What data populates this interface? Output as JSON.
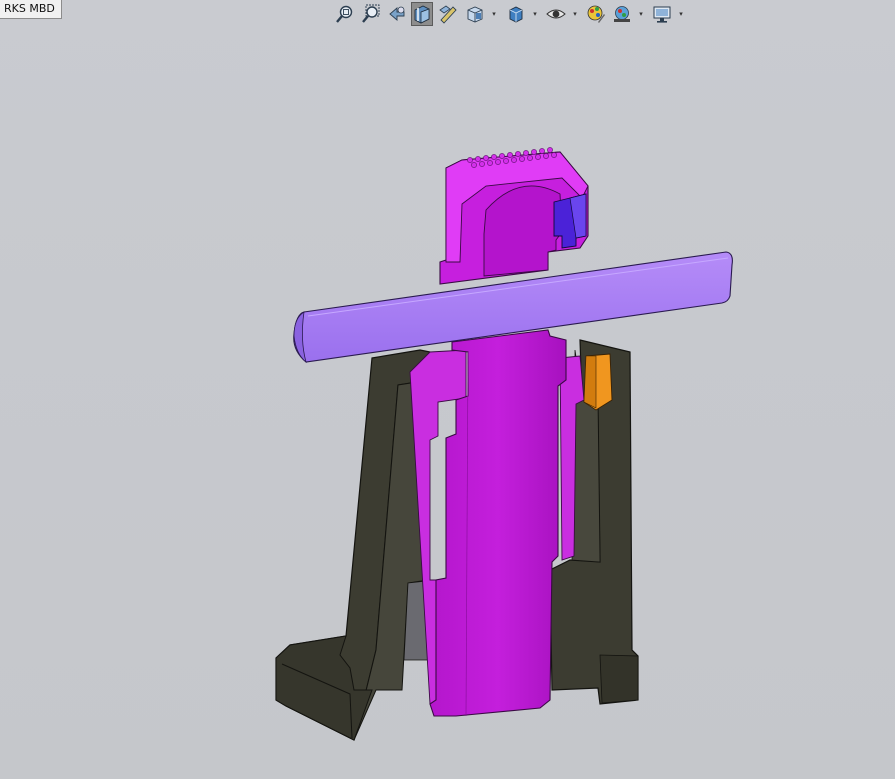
{
  "window": {
    "tab_label": "RKS MBD"
  },
  "toolbar": {
    "icons": [
      "zoom-to-fit-icon",
      "zoom-to-area-icon",
      "previous-view-icon",
      "section-view-icon",
      "dynamic-annotation-views-icon",
      "view-orientation-icon",
      "display-style-icon",
      "hide-show-items-icon",
      "edit-appearance-icon",
      "apply-scene-icon",
      "view-settings-icon"
    ],
    "active_icon": "section-view-icon"
  },
  "colors": {
    "background": "#c7c9ce",
    "magenta_part": "#c81de0",
    "magenta_light": "#e23af5",
    "pin_lavender": "#a57cf5",
    "housing_dark": "#3b3b30",
    "accent_orange": "#f0961f",
    "accent_blue": "#4b22d8"
  }
}
